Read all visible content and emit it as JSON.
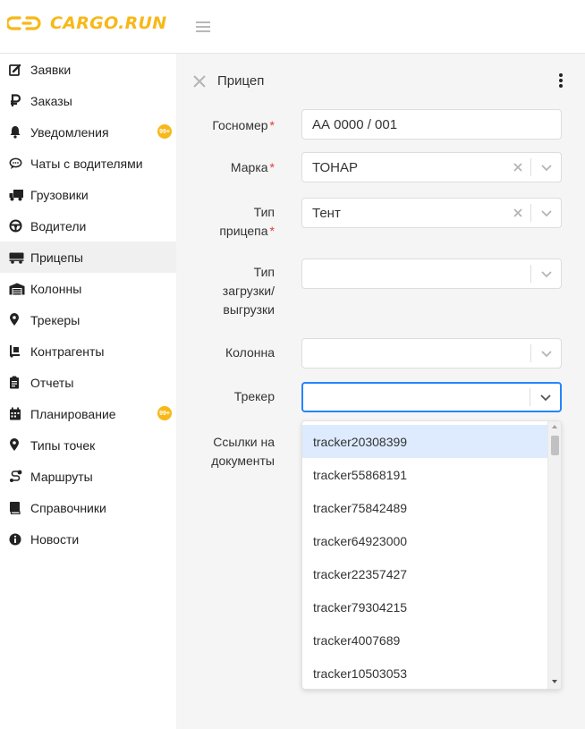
{
  "app": {
    "logo_text": "CARGO.RUN",
    "brand_color": "#f7b818"
  },
  "sidebar": {
    "items": [
      {
        "label": "Заявки",
        "icon": "edit-icon"
      },
      {
        "label": "Заказы",
        "icon": "ruble-icon"
      },
      {
        "label": "Уведомления",
        "icon": "bell-icon",
        "badge": "99+"
      },
      {
        "label": "Чаты с водителями",
        "icon": "chat-icon"
      },
      {
        "label": "Грузовики",
        "icon": "truck-icon"
      },
      {
        "label": "Водители",
        "icon": "steering-wheel-icon"
      },
      {
        "label": "Прицепы",
        "icon": "trailer-icon",
        "active": true
      },
      {
        "label": "Колонны",
        "icon": "warehouse-icon"
      },
      {
        "label": "Трекеры",
        "icon": "map-pin-icon"
      },
      {
        "label": "Контрагенты",
        "icon": "dolly-icon"
      },
      {
        "label": "Отчеты",
        "icon": "clipboard-icon"
      },
      {
        "label": "Планирование",
        "icon": "calendar-icon",
        "badge": "99+"
      },
      {
        "label": "Типы точек",
        "icon": "map-pin-icon"
      },
      {
        "label": "Маршруты",
        "icon": "route-icon"
      },
      {
        "label": "Справочники",
        "icon": "book-icon"
      },
      {
        "label": "Новости",
        "icon": "info-icon"
      }
    ]
  },
  "form": {
    "title": "Прицеп",
    "required_mark": "*",
    "gosnomer": {
      "label": "Госномер",
      "value": "АА 0000 / 001"
    },
    "marka": {
      "label": "Марка",
      "value": "ТОНАР"
    },
    "tip_pricepa": {
      "label_line1": "Тип",
      "label_line2": "прицепа",
      "value": "Тент"
    },
    "tip_zagruzki": {
      "label_line1": "Тип",
      "label_line2": "загрузки/",
      "label_line3": "выгрузки",
      "value": ""
    },
    "kolonna": {
      "label": "Колонна",
      "value": ""
    },
    "treker": {
      "label": "Трекер",
      "value": ""
    },
    "ssylki": {
      "label_line1": "Ссылки на",
      "label_line2": "документы"
    }
  },
  "dropdown": {
    "options": [
      "tracker20308399",
      "tracker55868191",
      "tracker75842489",
      "tracker64923000",
      "tracker22357427",
      "tracker79304215",
      "tracker4007689",
      "tracker10503053"
    ],
    "highlighted_index": 0
  }
}
